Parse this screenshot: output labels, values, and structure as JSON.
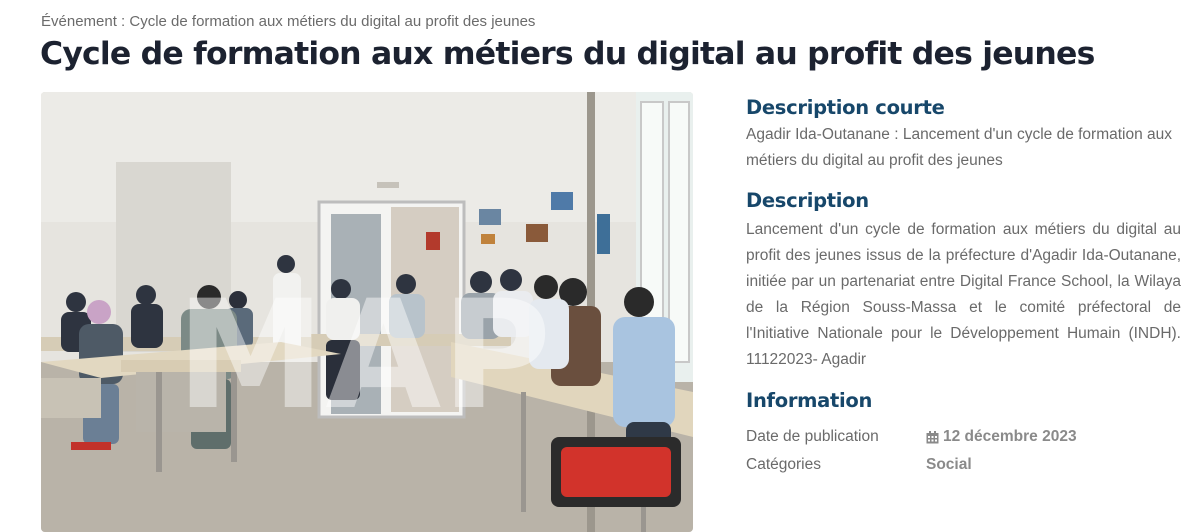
{
  "breadcrumb": "Événement : Cycle de formation aux métiers du digital au profit des jeunes",
  "title": "Cycle de formation aux métiers du digital au profit des jeunes",
  "photo": {
    "watermark": "MAP",
    "icon": "event-photo"
  },
  "short_description": {
    "heading": "Description courte",
    "text": "Agadir Ida-Outanane : Lancement d'un cycle de formation aux métiers du digital au profit des jeunes"
  },
  "description": {
    "heading": "Description",
    "text": "Lancement d'un cycle de formation aux métiers du digital au profit des jeunes issus de la préfecture d'Agadir Ida-Outanane, initiée par un partenariat entre Digital France School, la Wilaya de la Région Souss-Massa et le comité préfectoral de l'Initiative Nationale pour le Développement Humain (INDH). 11122023- Agadir"
  },
  "information": {
    "heading": "Information",
    "publication_label": "Date de publication",
    "publication_date": "12 décembre 2023",
    "publication_icon": "calendar-icon",
    "categories_label": "Catégories",
    "categories_value": "Social"
  },
  "colors": {
    "heading": "#17476a",
    "title": "#1c2230",
    "text": "#6a6a6a"
  }
}
